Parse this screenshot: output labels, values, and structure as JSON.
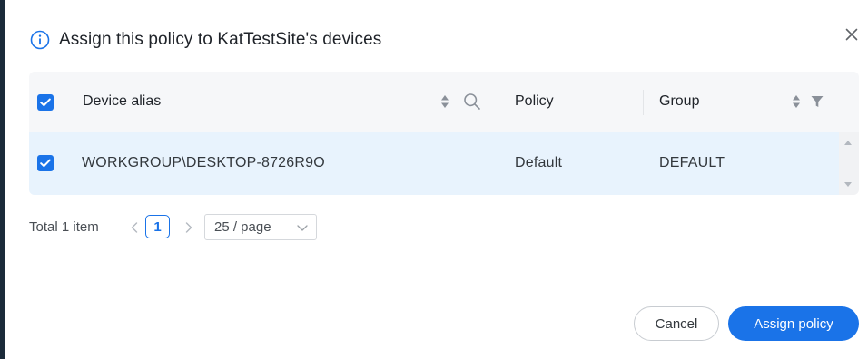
{
  "dialog": {
    "title": "Assign this policy to KatTestSite's devices",
    "close_icon": "close-icon",
    "info_icon": "info-icon"
  },
  "table": {
    "columns": [
      {
        "key": "device_alias",
        "label": "Device alias",
        "icons": [
          "sort-icon",
          "search-icon"
        ]
      },
      {
        "key": "policy",
        "label": "Policy",
        "icons": []
      },
      {
        "key": "group",
        "label": "Group",
        "icons": [
          "sort-icon",
          "filter-icon"
        ]
      }
    ],
    "header_checked": true,
    "rows": [
      {
        "checked": true,
        "device_alias": "WORKGROUP\\DESKTOP-8726R9O",
        "policy": "Default",
        "group": "DEFAULT"
      }
    ]
  },
  "pagination": {
    "total_label": "Total 1 item",
    "current_page": "1",
    "page_size": "25 / page"
  },
  "footer": {
    "cancel_label": "Cancel",
    "assign_label": "Assign policy"
  },
  "colors": {
    "accent": "#1a73e8",
    "selected_row": "#e8f3fd",
    "header_bg": "#f6f7f9"
  }
}
